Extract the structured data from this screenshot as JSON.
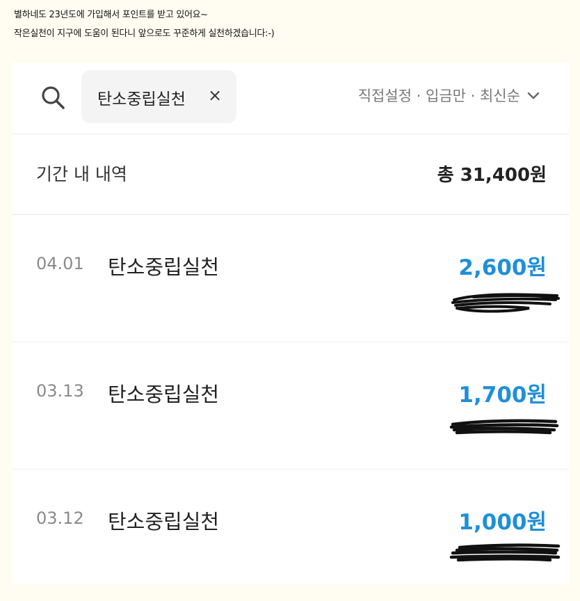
{
  "caption": {
    "line1": "별하네도 23년도에 가입해서 포인트를 받고 있어요~",
    "line2": "작은실천이 지구에 도움이 된다니 앞으로도 꾸준하게 실천하겠습니다:-)"
  },
  "search": {
    "chip_label": "탄소중립실천",
    "chip_close": "×",
    "filter_label": "직접설정 · 입금만 · 최신순"
  },
  "summary": {
    "label": "기간 내 내역",
    "total": "총 31,400원"
  },
  "entries": [
    {
      "date": "04.01",
      "title": "탄소중립실천",
      "amount": "2,600원"
    },
    {
      "date": "03.13",
      "title": "탄소중립실천",
      "amount": "1,700원"
    },
    {
      "date": "03.12",
      "title": "탄소중립실천",
      "amount": "1,000원"
    }
  ],
  "colors": {
    "amount": "#1f8fd8",
    "background": "#fffdf2",
    "chip": "#f4f4f4"
  },
  "icons": {
    "search": "search-icon",
    "close": "close-icon",
    "chevron": "chevron-down-icon"
  }
}
